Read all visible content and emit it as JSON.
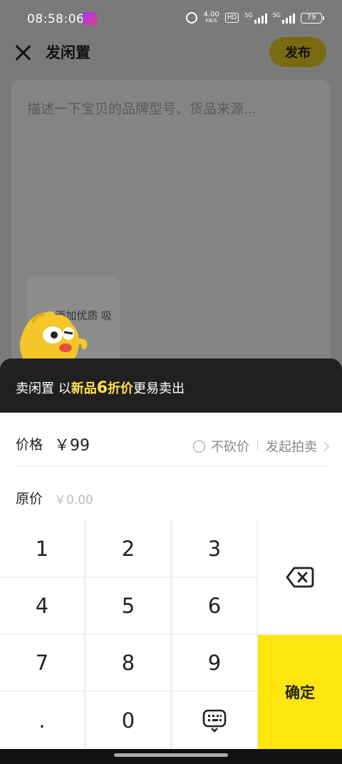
{
  "status_bar": {
    "time": "08:58:06",
    "net_speed_value": "4.00",
    "net_speed_unit": "KB/S",
    "hd_label": "HD",
    "sim1_label": "5G",
    "sim2_label": "5G",
    "battery": "79",
    "icons": [
      "app-icon",
      "alarm-icon",
      "signal-icon",
      "battery-icon"
    ]
  },
  "header": {
    "title": "发闲置",
    "publish_label": "发布",
    "close_icon": "close-icon"
  },
  "description": {
    "placeholder": "描述一下宝贝的品牌型号、货品来源...",
    "add_photo_text": "+ 添加优质  吸引人~"
  },
  "promo": {
    "prefix": "卖闲置 以",
    "highlight1": "新品",
    "number": "6",
    "highlight2": "折价",
    "suffix": "更易卖出"
  },
  "price": {
    "label": "价格",
    "value": "￥99",
    "no_bargain_label": "不砍价",
    "auction_label": "发起拍卖"
  },
  "original_price": {
    "label": "原价",
    "placeholder": "￥0.00"
  },
  "keypad": {
    "keys": [
      "1",
      "2",
      "3",
      "4",
      "5",
      "6",
      "7",
      "8",
      "9",
      ".",
      "0"
    ],
    "confirm_label": "确定",
    "delete_icon": "backspace-icon",
    "keyboard_icon": "keyboard-hide-icon"
  },
  "colors": {
    "accent_yellow": "#ffe60f",
    "promo_highlight": "#ffe14a",
    "promo_bg": "#202020",
    "overlay": "#7a7a7a"
  }
}
